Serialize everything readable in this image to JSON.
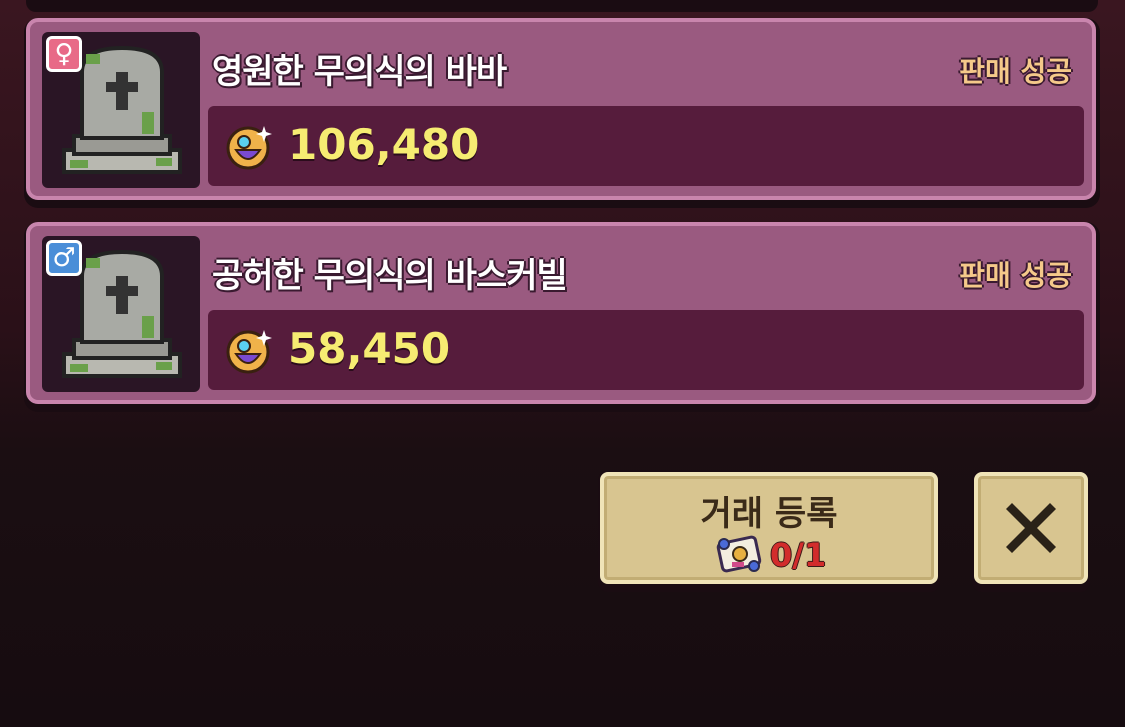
{
  "listings": [
    {
      "gender": "female",
      "gender_symbol": "♀",
      "gender_color": "#e86a87",
      "icon": "tombstone-icon",
      "name": "영원한 무의식의 바바",
      "status": "판매 성공",
      "price": "106,480"
    },
    {
      "gender": "male",
      "gender_symbol": "♂",
      "gender_color": "#4a8ed8",
      "icon": "tombstone-icon",
      "name": "공허한 무의식의 바스커빌",
      "status": "판매 성공",
      "price": "58,450"
    }
  ],
  "actions": {
    "register_label": "거래 등록",
    "register_count": "0/1",
    "close_icon": "close-icon"
  },
  "colors": {
    "card_bg": "#9a5a80",
    "price_bg": "#561c3c",
    "price_text": "#f6ec72",
    "status_text": "#f5c98a",
    "button_bg": "#d8c590",
    "count_text": "#d22c2c"
  }
}
